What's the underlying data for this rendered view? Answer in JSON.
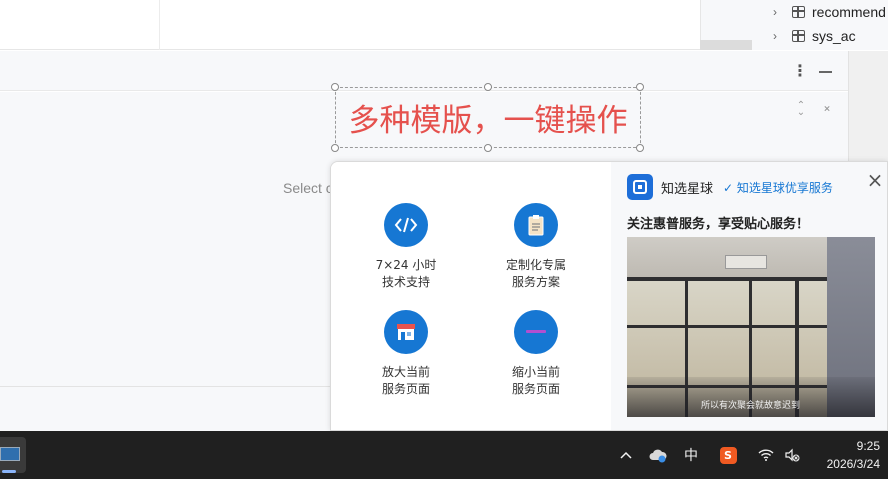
{
  "tree": {
    "items": [
      {
        "label": "recommend"
      },
      {
        "label": "sys_ac"
      }
    ]
  },
  "editor": {
    "placeholder_text": "Select c"
  },
  "banner": {
    "text": "多种模版，一键操作"
  },
  "popup": {
    "services": [
      {
        "line1": "7×24 小时",
        "line2": "技术支持",
        "icon": "code-icon"
      },
      {
        "line1": "定制化专属",
        "line2": "服务方案",
        "icon": "clipboard-icon"
      },
      {
        "line1": "放大当前",
        "line2": "服务页面",
        "icon": "store-icon"
      },
      {
        "line1": "缩小当前",
        "line2": "服务页面",
        "icon": "minus-icon"
      }
    ],
    "brand_name": "知选星球",
    "brand_link": "✓ 知选星球优享服务",
    "follow_text": "关注惠普服务，享受贴心服务！",
    "video_caption": "所以有次聚会就故意迟到"
  },
  "taskbar": {
    "ime_label": "中",
    "sogou_label": "S",
    "time": "9:25",
    "date": "2026/3/24"
  },
  "colors": {
    "accent_blue": "#1677d3",
    "banner_red": "#e5514d",
    "taskbar": "#202020"
  }
}
